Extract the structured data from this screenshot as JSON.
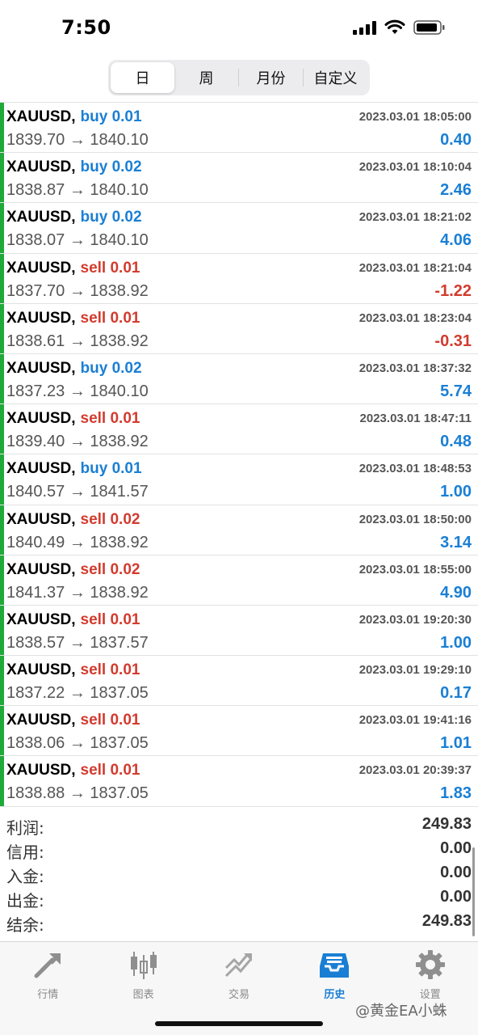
{
  "status": {
    "time": "7:50"
  },
  "segments": [
    {
      "label": "日",
      "active": true
    },
    {
      "label": "周",
      "active": false
    },
    {
      "label": "月份",
      "active": false
    },
    {
      "label": "自定义",
      "active": false
    }
  ],
  "trades": [
    {
      "symbol": "XAUUSD,",
      "side": "buy 0.01",
      "type": "buy",
      "prices": "1839.70 → 1840.10",
      "time": "2023.03.01 18:05:00",
      "profit": "0.40"
    },
    {
      "symbol": "XAUUSD,",
      "side": "buy 0.02",
      "type": "buy",
      "prices": "1838.87 → 1840.10",
      "time": "2023.03.01 18:10:04",
      "profit": "2.46"
    },
    {
      "symbol": "XAUUSD,",
      "side": "buy 0.02",
      "type": "buy",
      "prices": "1838.07 → 1840.10",
      "time": "2023.03.01 18:21:02",
      "profit": "4.06"
    },
    {
      "symbol": "XAUUSD,",
      "side": "sell 0.01",
      "type": "sell",
      "prices": "1837.70 → 1838.92",
      "time": "2023.03.01 18:21:04",
      "profit": "-1.22"
    },
    {
      "symbol": "XAUUSD,",
      "side": "sell 0.01",
      "type": "sell",
      "prices": "1838.61 → 1838.92",
      "time": "2023.03.01 18:23:04",
      "profit": "-0.31"
    },
    {
      "symbol": "XAUUSD,",
      "side": "buy 0.02",
      "type": "buy",
      "prices": "1837.23 → 1840.10",
      "time": "2023.03.01 18:37:32",
      "profit": "5.74"
    },
    {
      "symbol": "XAUUSD,",
      "side": "sell 0.01",
      "type": "sell",
      "prices": "1839.40 → 1838.92",
      "time": "2023.03.01 18:47:11",
      "profit": "0.48"
    },
    {
      "symbol": "XAUUSD,",
      "side": "buy 0.01",
      "type": "buy",
      "prices": "1840.57 → 1841.57",
      "time": "2023.03.01 18:48:53",
      "profit": "1.00"
    },
    {
      "symbol": "XAUUSD,",
      "side": "sell 0.02",
      "type": "sell",
      "prices": "1840.49 → 1838.92",
      "time": "2023.03.01 18:50:00",
      "profit": "3.14"
    },
    {
      "symbol": "XAUUSD,",
      "side": "sell 0.02",
      "type": "sell",
      "prices": "1841.37 → 1838.92",
      "time": "2023.03.01 18:55:00",
      "profit": "4.90"
    },
    {
      "symbol": "XAUUSD,",
      "side": "sell 0.01",
      "type": "sell",
      "prices": "1838.57 → 1837.57",
      "time": "2023.03.01 19:20:30",
      "profit": "1.00"
    },
    {
      "symbol": "XAUUSD,",
      "side": "sell 0.01",
      "type": "sell",
      "prices": "1837.22 → 1837.05",
      "time": "2023.03.01 19:29:10",
      "profit": "0.17"
    },
    {
      "symbol": "XAUUSD,",
      "side": "sell 0.01",
      "type": "sell",
      "prices": "1838.06 → 1837.05",
      "time": "2023.03.01 19:41:16",
      "profit": "1.01"
    },
    {
      "symbol": "XAUUSD,",
      "side": "sell 0.01",
      "type": "sell",
      "prices": "1838.88 → 1837.05",
      "time": "2023.03.01 20:39:37",
      "profit": "1.83"
    }
  ],
  "summary": [
    {
      "label": "利润:",
      "value": "249.83"
    },
    {
      "label": "信用:",
      "value": "0.00"
    },
    {
      "label": "入金:",
      "value": "0.00"
    },
    {
      "label": "出金:",
      "value": "0.00"
    },
    {
      "label": "结余:",
      "value": "249.83"
    }
  ],
  "tabs": [
    {
      "label": "行情",
      "icon": "quotes-icon",
      "active": false
    },
    {
      "label": "图表",
      "icon": "chart-icon",
      "active": false
    },
    {
      "label": "交易",
      "icon": "trade-icon",
      "active": false
    },
    {
      "label": "历史",
      "icon": "history-icon",
      "active": true
    },
    {
      "label": "设置",
      "icon": "settings-icon",
      "active": false
    }
  ],
  "watermark": "@黄金EA小蛛",
  "colors": {
    "buy": "#1a7fd4",
    "sell": "#d23b2e",
    "profit_bar": "#1faa38",
    "active_tab": "#1a7fd4"
  }
}
